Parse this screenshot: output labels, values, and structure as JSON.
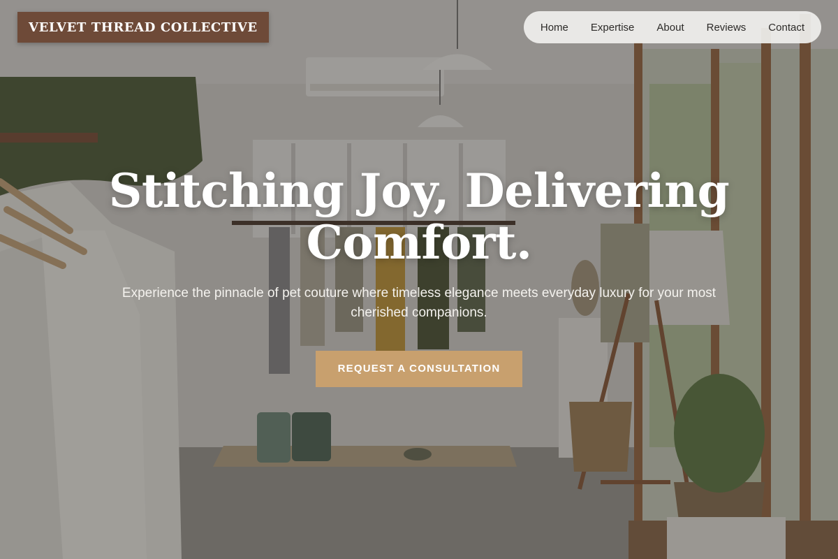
{
  "brand": {
    "name": "VELVET THREAD COLLECTIVE"
  },
  "nav": {
    "items": [
      {
        "label": "Home"
      },
      {
        "label": "Expertise"
      },
      {
        "label": "About"
      },
      {
        "label": "Reviews"
      },
      {
        "label": "Contact"
      }
    ]
  },
  "hero": {
    "title": "Stitching Joy, Delivering Comfort.",
    "subtitle": "Experience the pinnacle of pet couture where timeless elegance meets everyday luxury for your most cherished companions.",
    "cta_label": "REQUEST A CONSULTATION"
  },
  "colors": {
    "logo_bg": "#6e4a38",
    "nav_bg": "#f0f0ee",
    "cta_bg": "#c8a06e",
    "text_light": "#ffffff"
  }
}
